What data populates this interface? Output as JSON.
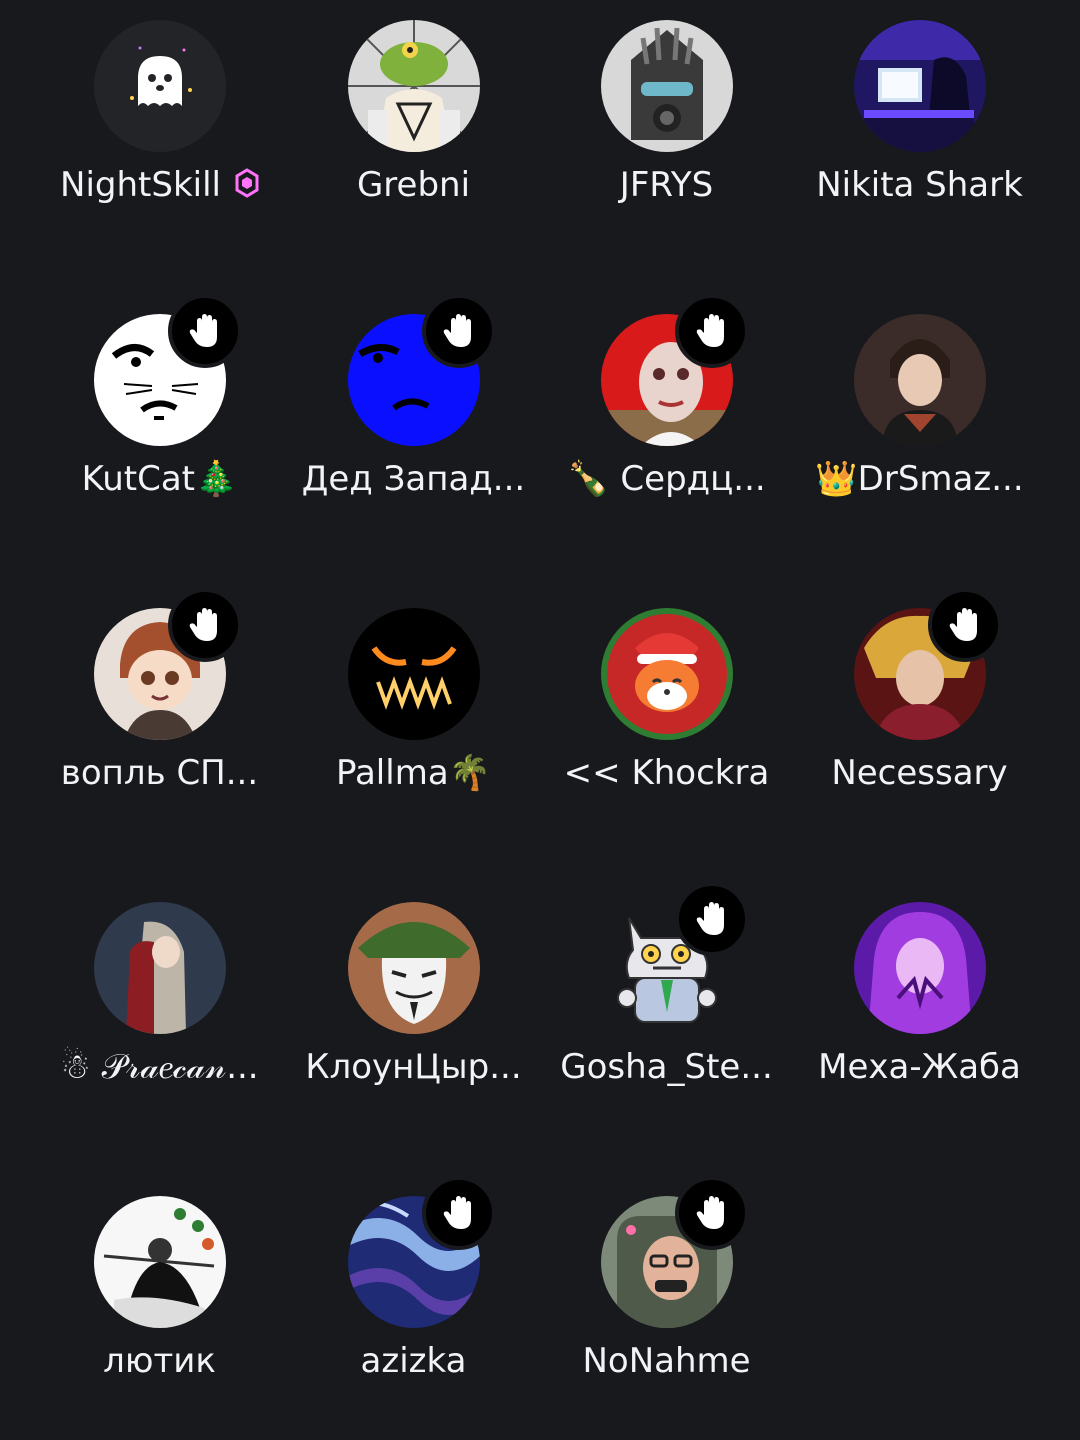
{
  "members": [
    {
      "name": "NightSkill",
      "badge": "nitro-boost",
      "wave": false,
      "avatar": "ghost"
    },
    {
      "name": "Grebni",
      "wave": false,
      "avatar": "frog"
    },
    {
      "name": "JFRYS",
      "wave": false,
      "avatar": "masked-figure"
    },
    {
      "name": "Nikita Shark",
      "wave": false,
      "avatar": "gaming-room"
    },
    {
      "name": "KutCat🎄",
      "wave": true,
      "avatar": "white-face"
    },
    {
      "name": "Дед Запад...",
      "wave": true,
      "avatar": "blue-face"
    },
    {
      "name": "🍾 Сердц...",
      "wave": true,
      "avatar": "red-photo"
    },
    {
      "name": "👑DrSmaz...",
      "wave": false,
      "avatar": "anime-boy"
    },
    {
      "name": "вопль СП...",
      "wave": true,
      "avatar": "chibi-boy"
    },
    {
      "name": "Pallma🌴",
      "wave": false,
      "avatar": "dark-grin"
    },
    {
      "name": "<< Khockra",
      "wave": false,
      "avatar": "fox-christmas"
    },
    {
      "name": "Necessary",
      "wave": true,
      "avatar": "anime-villain"
    },
    {
      "name": "☃ 𝒫𝓇𝒶𝑒𝒸𝒶𝓃...",
      "wave": false,
      "avatar": "anime-couple"
    },
    {
      "name": "КлоунЦыр...",
      "wave": false,
      "avatar": "vendetta-mask"
    },
    {
      "name": "Gosha_Ste...",
      "wave": true,
      "avatar": "cat-sticker"
    },
    {
      "name": "Меха-Жаба",
      "wave": false,
      "avatar": "purple-anime"
    },
    {
      "name": "лютик",
      "wave": false,
      "avatar": "anime-fighter"
    },
    {
      "name": "azizka",
      "wave": true,
      "avatar": "purple-marble"
    },
    {
      "name": "NoNahme",
      "wave": true,
      "avatar": "soldier-selfie"
    }
  ],
  "colors": {
    "background": "#18191d",
    "text": "#f2f3f5",
    "nitro": "#ff73fa"
  }
}
